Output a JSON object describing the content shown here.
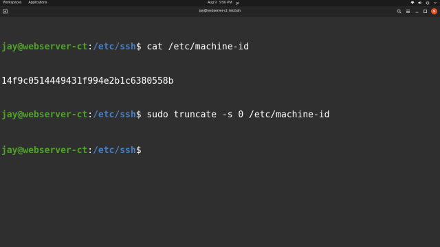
{
  "topbar": {
    "workspaces_label": "Workspaces",
    "applications_label": "Applications",
    "date": "Aug 9",
    "time": "9:56 PM",
    "icons": [
      "network-icon",
      "volume-icon",
      "power-icon",
      "settings-icon"
    ]
  },
  "window": {
    "title": "jay@webserver-ct: /etc/ssh",
    "buttons": [
      "new-tab-icon",
      "search-icon",
      "menu-icon",
      "minimize-icon",
      "maximize-icon",
      "close-icon"
    ],
    "close_color": "#e95420"
  },
  "terminal": {
    "lines": [
      {
        "type": "prompt",
        "user": "jay@webserver-ct",
        "path": "/etc/ssh",
        "command": " cat /etc/machine-id"
      },
      {
        "type": "output",
        "text": "14f9c0514449431f994e2b1c6380558b"
      },
      {
        "type": "prompt",
        "user": "jay@webserver-ct",
        "path": "/etc/ssh",
        "command": " sudo truncate -s 0 /etc/machine-id"
      },
      {
        "type": "prompt",
        "user": "jay@webserver-ct",
        "path": "/etc/ssh",
        "command": ""
      }
    ],
    "colors": {
      "background": "#2f2f2f",
      "user": "#4fa229",
      "path": "#4a7ec2",
      "text": "#ffffff"
    }
  }
}
